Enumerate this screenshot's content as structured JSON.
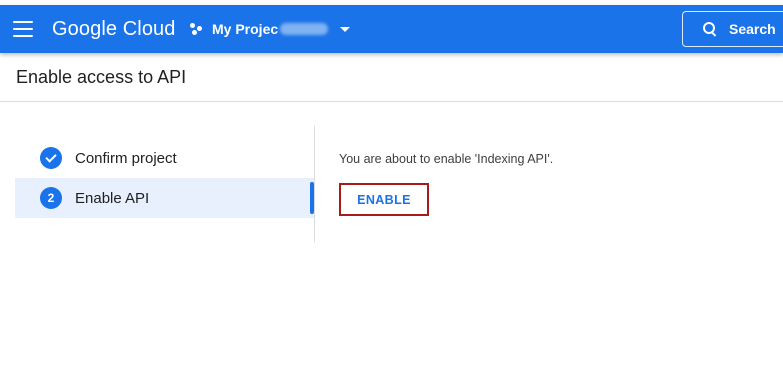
{
  "topbar": {
    "brand": "Google Cloud",
    "project_name": "My Projec",
    "search_label": "Search",
    "icons": [
      "menu-icon",
      "project-icon",
      "chevron-down-icon",
      "search-icon"
    ]
  },
  "page": {
    "title": "Enable access to API"
  },
  "steps": [
    {
      "label": "Confirm project",
      "status": "complete",
      "icon": "check-icon"
    },
    {
      "label": "Enable API",
      "status": "active",
      "number": "2"
    }
  ],
  "content": {
    "message": "You are about to enable 'Indexing API'.",
    "enable_label": "ENABLE"
  },
  "colors": {
    "accent": "#1a73e8",
    "highlight_border": "#a61c1c",
    "active_step_bg": "#e8f0fe"
  }
}
